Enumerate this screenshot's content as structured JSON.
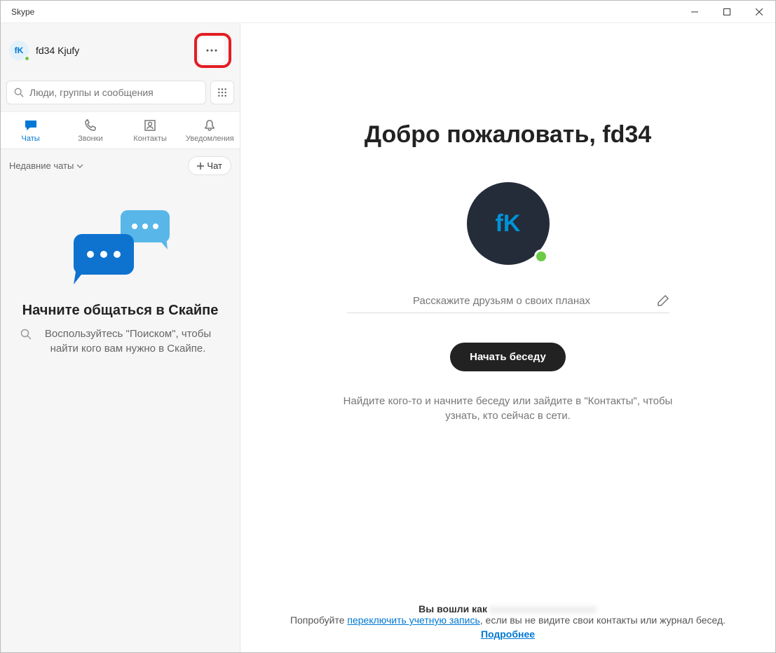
{
  "window": {
    "title": "Skype"
  },
  "profile": {
    "initials": "fK",
    "name": "fd34 Kjufy"
  },
  "search": {
    "placeholder": "Люди, группы и сообщения"
  },
  "tabs": {
    "chats": "Чаты",
    "calls": "Звонки",
    "contacts": "Контакты",
    "notifications": "Уведомления"
  },
  "recent": {
    "label": "Недавние чаты",
    "chat_btn": "Чат"
  },
  "empty": {
    "title": "Начните общаться в Скайпе",
    "desc": "Воспользуйтесь \"Поиском\", чтобы найти кого вам нужно в Скайпе."
  },
  "main": {
    "welcome": "Добро пожаловать, fd34",
    "avatar_initials": "fK",
    "status_placeholder": "Расскажите друзьям о своих планах",
    "start_btn": "Начать беседу",
    "find_desc": "Найдите кого-то и начните беседу или зайдите в \"Контакты\", чтобы узнать, кто сейчас в сети."
  },
  "footer": {
    "signed_in_as": "Вы вошли как",
    "try_text": "Попробуйте ",
    "switch_link": "переключить учетную запись",
    "after_switch": ", если вы не видите свои контакты или журнал бесед.",
    "more": "Подробнее"
  }
}
